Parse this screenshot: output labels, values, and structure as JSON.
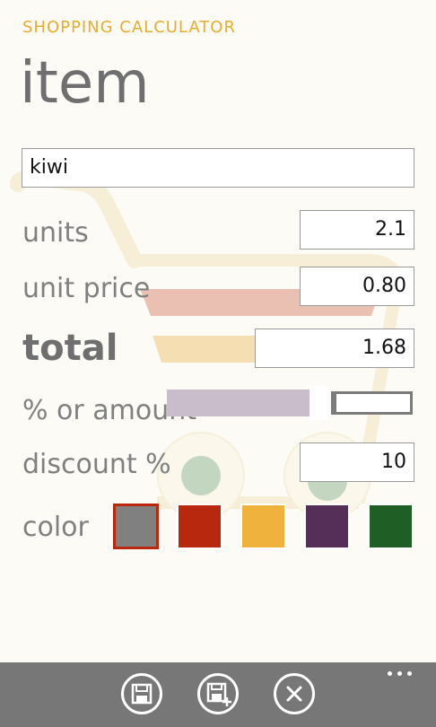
{
  "header": {
    "app_title": "SHOPPING CALCULATOR",
    "page_title": "item"
  },
  "form": {
    "item_name": "kiwi",
    "units_label": "units",
    "units_value": "2.1",
    "unit_price_label": "unit price",
    "unit_price_value": "0.80",
    "total_label": "total",
    "total_value": "1.68",
    "discount_mode_label": "% or amount",
    "discount_mode_toggle_level": 0.8,
    "discount_label": "discount %",
    "discount_value": "10",
    "color_label": "color"
  },
  "colors": {
    "accent": "#e8ac2e",
    "label": "#808080",
    "app_bar": "#777777",
    "swatches": [
      "#808080",
      "#b8280e",
      "#efb23d",
      "#562f59",
      "#1f5f26"
    ],
    "selected_swatch_index": 0
  },
  "app_bar": {
    "buttons": [
      "save-icon",
      "save-as-new-icon",
      "cancel-icon"
    ],
    "more": "ellipsis-icon"
  }
}
